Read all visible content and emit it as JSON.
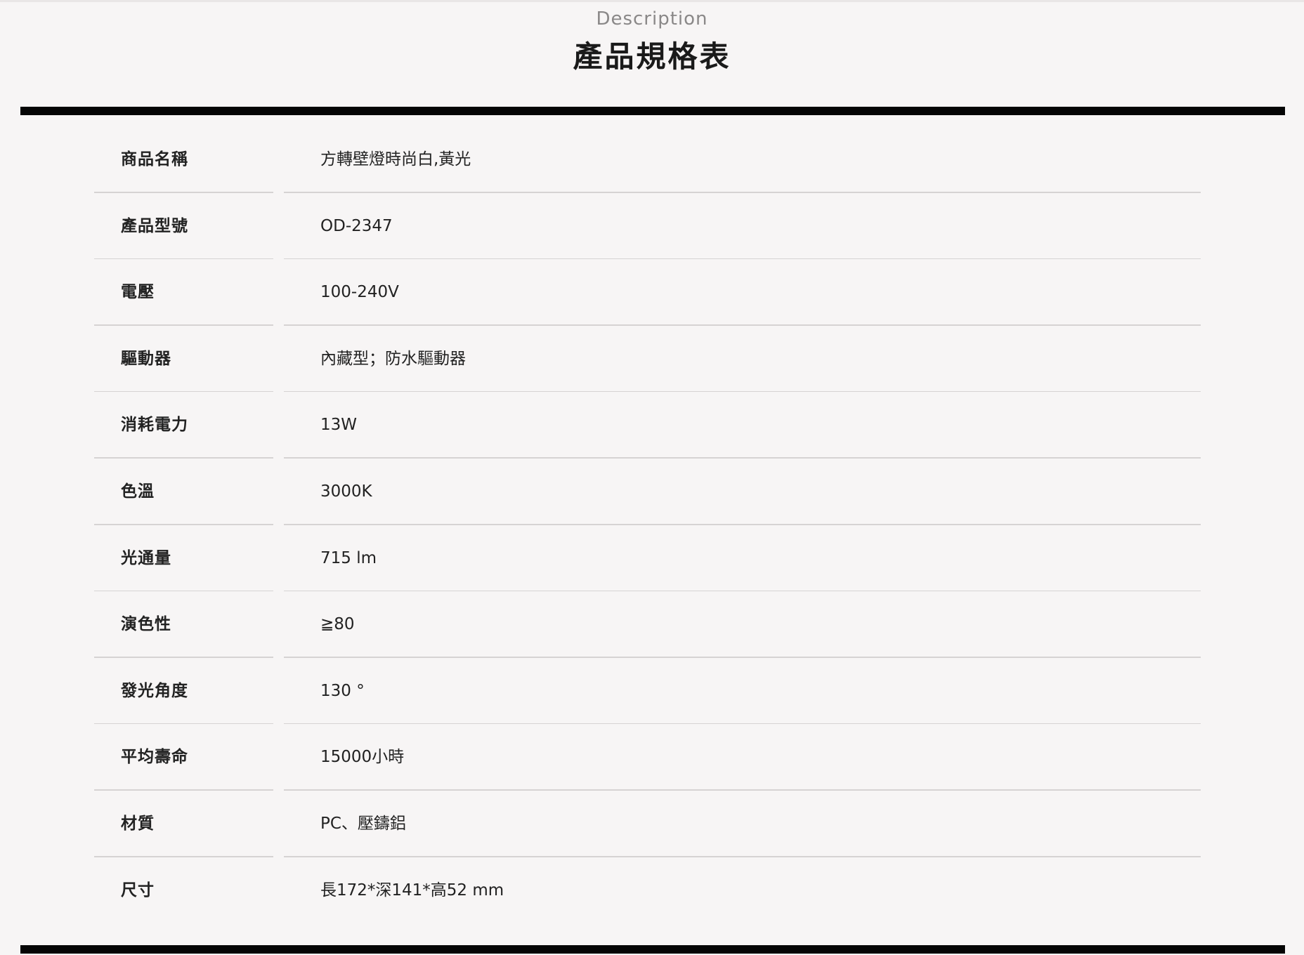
{
  "header": {
    "subtitle": "Description",
    "title": "產品規格表"
  },
  "specs": [
    {
      "label": "商品名稱",
      "value": "方轉壁燈時尚白,黃光"
    },
    {
      "label": "產品型號",
      "value": "OD-2347"
    },
    {
      "label": "電壓",
      "value": "100-240V"
    },
    {
      "label": "驅動器",
      "value": "內藏型；防水驅動器"
    },
    {
      "label": "消耗電力",
      "value": "13W"
    },
    {
      "label": "色溫",
      "value": "3000K"
    },
    {
      "label": "光通量",
      "value": "715 lm"
    },
    {
      "label": "演色性",
      "value": "≧80"
    },
    {
      "label": "發光角度",
      "value": "130 °"
    },
    {
      "label": "平均壽命",
      "value": "15000小時"
    },
    {
      "label": "材質",
      "value": "PC、壓鑄鋁"
    },
    {
      "label": "尺寸",
      "value": "長172*深141*高52 mm"
    }
  ],
  "colors": {
    "background": "#f7f5f5",
    "text": "#222222",
    "subtitle": "#8a8888",
    "bar": "#050505",
    "divider": "#d6d3d3"
  }
}
